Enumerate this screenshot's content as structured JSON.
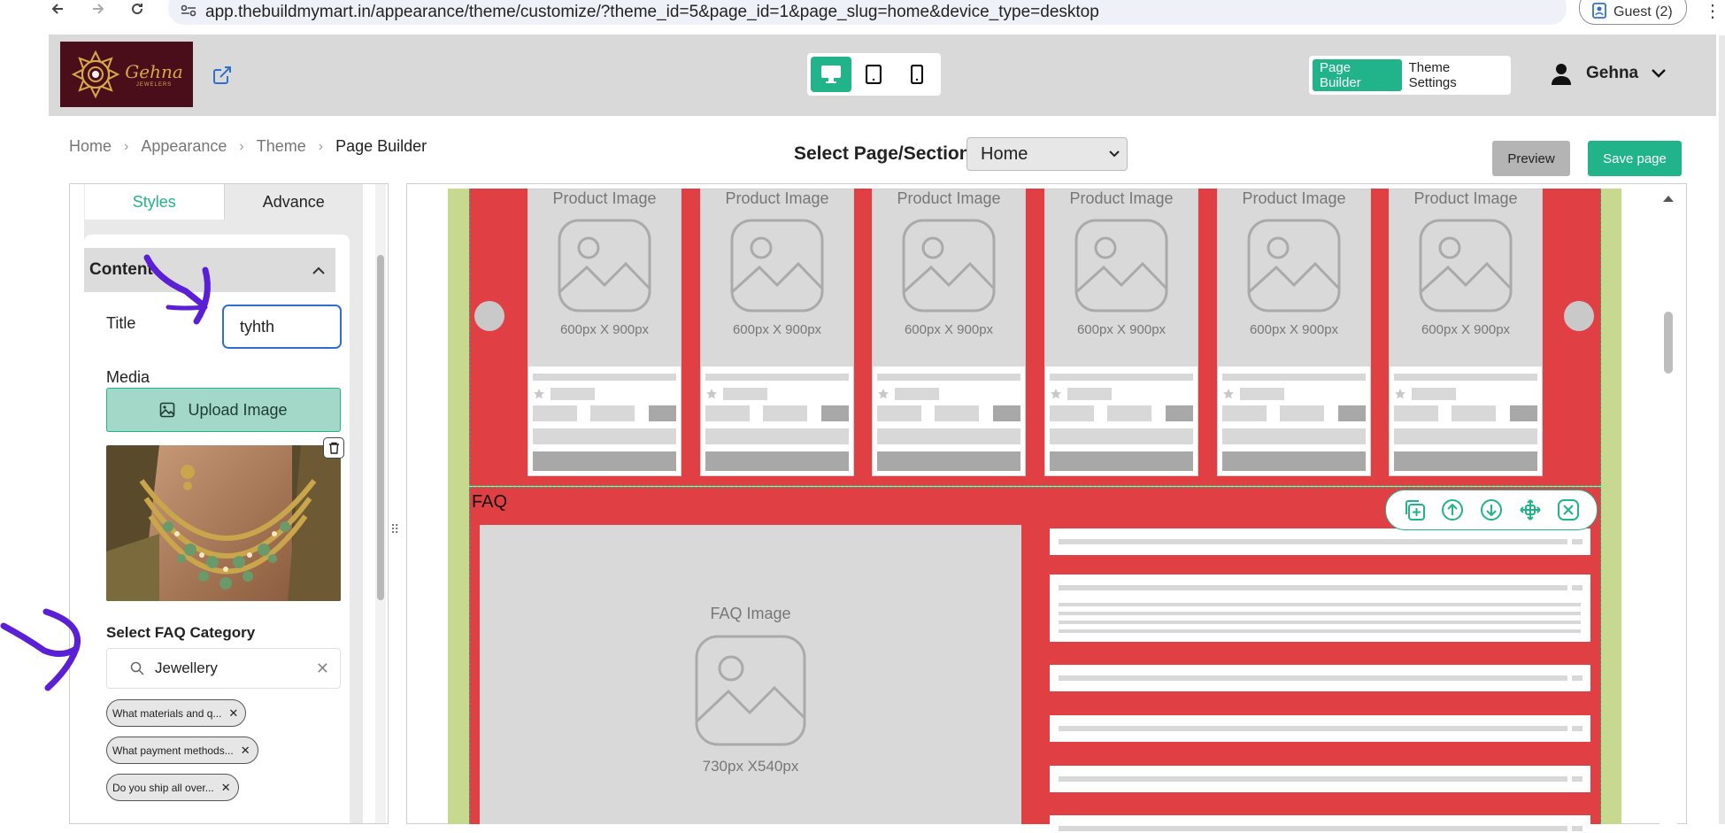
{
  "browser": {
    "url": "app.thebuildmymart.in/appearance/theme/customize/?theme_id=5&page_id=1&page_slug=home&device_type=desktop",
    "profile": "Guest (2)"
  },
  "header": {
    "logo_text": "Gehna",
    "logo_sub": "JEWELERS",
    "mode_page_builder": "Page Builder",
    "mode_theme_settings": "Theme Settings",
    "user_name": "Gehna"
  },
  "breadcrumb": [
    "Home",
    "Appearance",
    "Theme",
    "Page Builder"
  ],
  "page_select": {
    "label": "Select Page/Section:",
    "value": "Home"
  },
  "actions": {
    "preview": "Preview",
    "save": "Save page"
  },
  "panel": {
    "tabs": [
      "Styles",
      "Advance"
    ],
    "section_title": "Content",
    "title_label": "Title",
    "title_value": "tyhth",
    "media_label": "Media",
    "upload_label": "Upload Image",
    "faq_category_label": "Select FAQ Category",
    "faq_category_value": "Jewellery",
    "chips": [
      "What materials and q...",
      "What payment methods...",
      "Do you ship all over..."
    ]
  },
  "canvas": {
    "product_label": "Product Image",
    "product_dim": "600px X 900px",
    "faq_title": "FAQ",
    "faq_image_label": "FAQ Image",
    "faq_image_dim": "730px X540px"
  },
  "colors": {
    "accent": "#21b38a",
    "section_red": "#e04043",
    "canvas_green": "#c7d98f",
    "annotation": "#5b1fd6"
  }
}
